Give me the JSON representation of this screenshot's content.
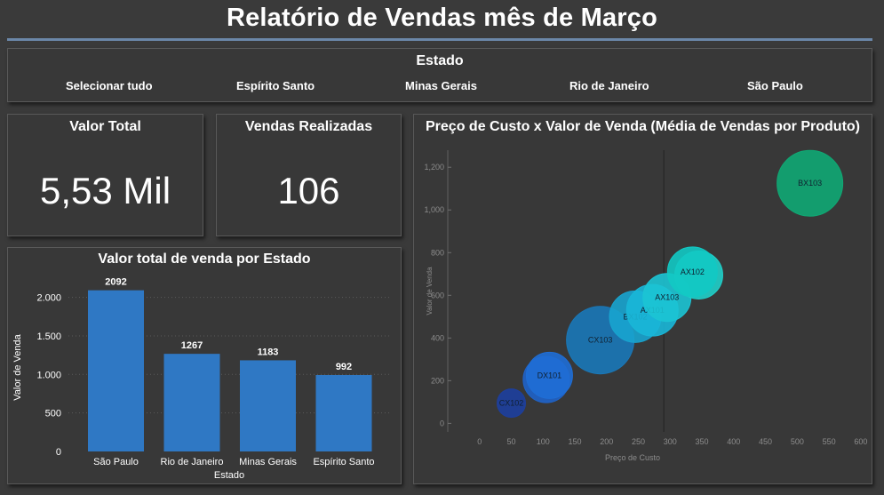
{
  "report": {
    "title": "Relatório de Vendas mês de Março"
  },
  "slicer": {
    "title": "Estado",
    "items": [
      "Selecionar tudo",
      "Espírito Santo",
      "Minas Gerais",
      "Rio de Janeiro",
      "São Paulo"
    ]
  },
  "kpis": {
    "valor_total": {
      "label": "Valor Total",
      "value": "5,53 Mil"
    },
    "vendas_realizadas": {
      "label": "Vendas Realizadas",
      "value": "106"
    }
  },
  "colors": {
    "background": "#3a3a3a",
    "panel": "#383838",
    "bar": "#2f78c4",
    "accent_rule": "#6b87a8"
  },
  "chart_data": [
    {
      "type": "bar",
      "title": "Valor total de venda por Estado",
      "xlabel": "Estado",
      "ylabel": "Valor de Venda",
      "categories": [
        "São Paulo",
        "Rio de Janeiro",
        "Minas Gerais",
        "Espírito Santo"
      ],
      "values": [
        2092,
        1267,
        1183,
        992
      ],
      "data_labels": [
        "2092",
        "1267",
        "1183",
        "992"
      ],
      "ylim": [
        0,
        2180
      ],
      "yticks": [
        0,
        500,
        1000,
        1500,
        2000
      ],
      "ytick_labels": [
        "0",
        "500",
        "1.000",
        "1.500",
        "2.000"
      ],
      "grid": true
    },
    {
      "type": "scatter",
      "title": "Preço de Custo x Valor de Venda (Média de Vendas por Produto)",
      "xlabel": "Preço de Custo",
      "ylabel": "Valor de Venda",
      "xlim": [
        -50,
        610
      ],
      "ylim": [
        -40,
        1280
      ],
      "xticks": [
        0,
        50,
        100,
        150,
        200,
        250,
        300,
        350,
        400,
        450,
        500,
        550,
        600
      ],
      "xtick_labels": [
        "0",
        "50",
        "100",
        "150",
        "200",
        "250",
        "300",
        "350",
        "400",
        "450",
        "500",
        "550",
        "600"
      ],
      "yticks": [
        0,
        200,
        400,
        600,
        800,
        1000,
        1200
      ],
      "ytick_labels": [
        "0",
        "200",
        "400",
        "600",
        "800",
        "1,000",
        "1,200"
      ],
      "reference_line_x": 290,
      "points": [
        {
          "label": "CX102",
          "x": 50,
          "y": 95,
          "size": 16,
          "color": "#1d3f9e"
        },
        {
          "label": "",
          "x": 105,
          "y": 205,
          "size": 26,
          "color": "#1f63c9"
        },
        {
          "label": "DX101",
          "x": 110,
          "y": 225,
          "size": 26,
          "color": "#1f6ed6"
        },
        {
          "label": "CX103",
          "x": 190,
          "y": 390,
          "size": 38,
          "color": "#1a78b8"
        },
        {
          "label": "BX102",
          "x": 245,
          "y": 500,
          "size": 29,
          "color": "#18a4cf"
        },
        {
          "label": "AX101",
          "x": 272,
          "y": 530,
          "size": 29,
          "color": "#19b7d8"
        },
        {
          "label": "AX103",
          "x": 295,
          "y": 590,
          "size": 27,
          "color": "#1cc4d4"
        },
        {
          "label": "",
          "x": 345,
          "y": 695,
          "size": 27,
          "color": "#20cfc9"
        },
        {
          "label": "AX102",
          "x": 335,
          "y": 710,
          "size": 28,
          "color": "#12c9c4"
        },
        {
          "label": "BX103",
          "x": 520,
          "y": 1125,
          "size": 37,
          "color": "#10a874"
        }
      ]
    }
  ]
}
